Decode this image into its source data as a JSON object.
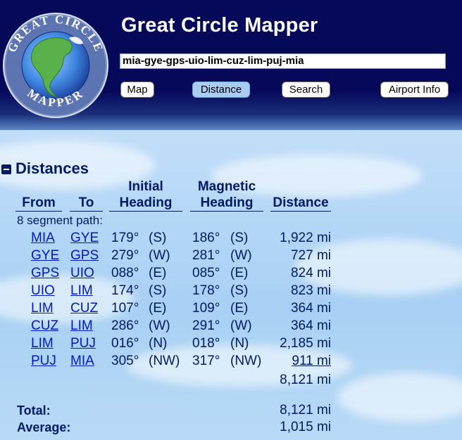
{
  "header": {
    "app_title": "Great Circle Mapper",
    "route_value": "mia-gye-gps-uio-lim-cuz-lim-puj-mia",
    "logo_top_text": "GREAT CIRCLE",
    "logo_bottom_text": "MAPPER",
    "buttons": {
      "map": "Map",
      "distance": "Distance",
      "search": "Search",
      "airport_info": "Airport Info"
    }
  },
  "distances": {
    "title": "Distances",
    "headers": {
      "from": "From",
      "to": "To",
      "initial_1": "Initial",
      "initial_2": "Heading",
      "magnetic_1": "Magnetic",
      "magnetic_2": "Heading",
      "distance": "Distance"
    },
    "segment_label": "8 segment path:",
    "rows": [
      {
        "from": "MIA",
        "to": "GYE",
        "ih": "179°",
        "id": "(S)",
        "mh": "186°",
        "md": "(S)",
        "dist": "1,922 mi"
      },
      {
        "from": "GYE",
        "to": "GPS",
        "ih": "279°",
        "id": "(W)",
        "mh": "281°",
        "md": "(W)",
        "dist": "727 mi"
      },
      {
        "from": "GPS",
        "to": "UIO",
        "ih": "088°",
        "id": "(E)",
        "mh": "085°",
        "md": "(E)",
        "dist": "824 mi"
      },
      {
        "from": "UIO",
        "to": "LIM",
        "ih": "174°",
        "id": "(S)",
        "mh": "178°",
        "md": "(S)",
        "dist": "823 mi"
      },
      {
        "from": "LIM",
        "to": "CUZ",
        "ih": "107°",
        "id": "(E)",
        "mh": "109°",
        "md": "(E)",
        "dist": "364 mi"
      },
      {
        "from": "CUZ",
        "to": "LIM",
        "ih": "286°",
        "id": "(W)",
        "mh": "291°",
        "md": "(W)",
        "dist": "364 mi"
      },
      {
        "from": "LIM",
        "to": "PUJ",
        "ih": "016°",
        "id": "(N)",
        "mh": "018°",
        "md": "(N)",
        "dist": "2,185 mi"
      },
      {
        "from": "PUJ",
        "to": "MIA",
        "ih": "305°",
        "id": "(NW)",
        "mh": "317°",
        "md": "(NW)",
        "dist": "911 mi"
      }
    ],
    "subtotal": "8,121 mi",
    "total_label": "Total:",
    "total_value": "8,121 mi",
    "average_label": "Average:",
    "average_value": "1,015 mi"
  }
}
